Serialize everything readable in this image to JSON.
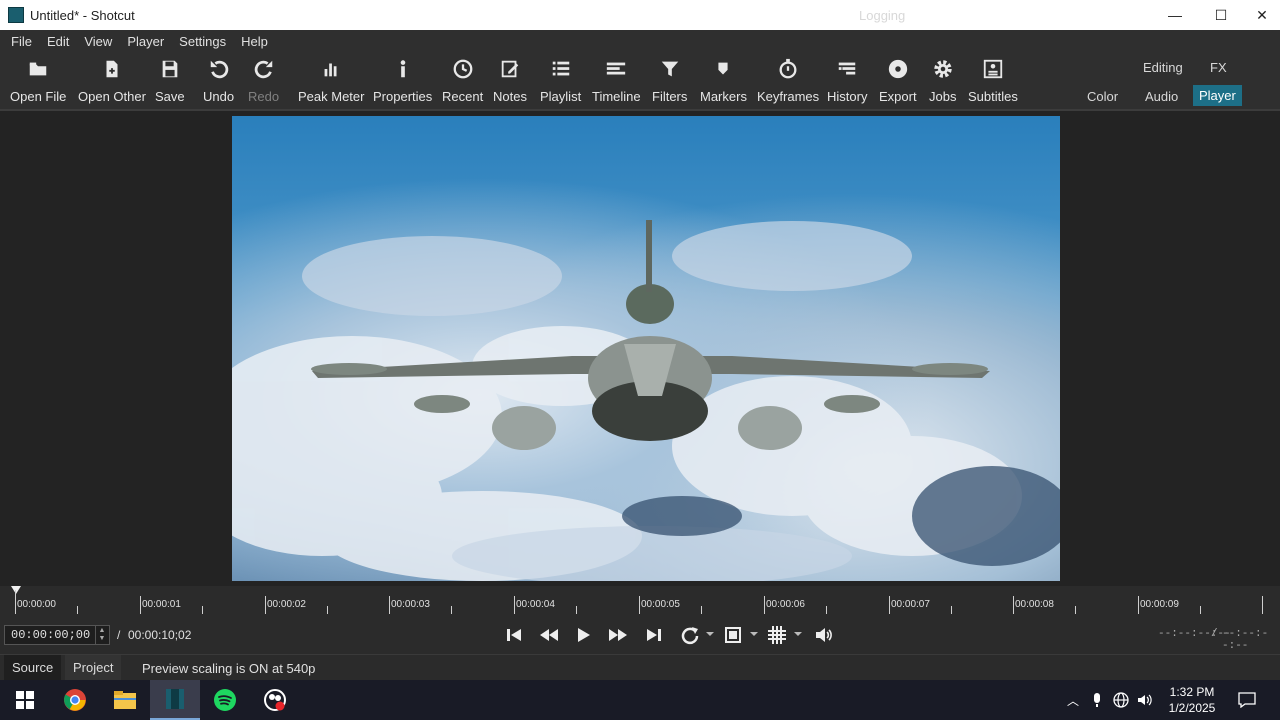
{
  "window": {
    "title": "Untitled* - Shotcut",
    "minimize": "—",
    "maximize": "☐",
    "close": "✕"
  },
  "menu": [
    "File",
    "Edit",
    "View",
    "Player",
    "Settings",
    "Help"
  ],
  "toolbar": {
    "open_file": "Open File",
    "open_other": "Open Other",
    "save": "Save",
    "undo": "Undo",
    "redo": "Redo",
    "peak_meter": "Peak Meter",
    "properties": "Properties",
    "recent": "Recent",
    "notes": "Notes",
    "playlist": "Playlist",
    "timeline": "Timeline",
    "filters": "Filters",
    "markers": "Markers",
    "keyframes": "Keyframes",
    "history": "History",
    "export": "Export",
    "jobs": "Jobs",
    "subtitles": "Subtitles"
  },
  "layouts": {
    "logging": "Logging",
    "editing": "Editing",
    "fx": "FX",
    "color": "Color",
    "audio": "Audio",
    "player": "Player",
    "active": "Player"
  },
  "ruler": {
    "labels": [
      "00:00:00",
      "00:00:01",
      "00:00:02",
      "00:00:03",
      "00:00:04",
      "00:00:05",
      "00:00:06",
      "00:00:07",
      "00:00:08",
      "00:00:09"
    ]
  },
  "transport": {
    "position": "00:00:00;00",
    "separator": "/",
    "duration": "00:00:10;02",
    "in_point": "--:--:--:--",
    "out_sep": "/",
    "out_point": "--:--:--:--"
  },
  "tabs": {
    "source": "Source",
    "project": "Project"
  },
  "status": "Preview scaling is ON at 540p",
  "taskbar": {
    "clock_time": "1:32 PM",
    "clock_date": "1/2/2025"
  },
  "colors": {
    "accent": "#1d6f87",
    "spotify": "#1ed760",
    "chrome_red": "#db4437"
  }
}
